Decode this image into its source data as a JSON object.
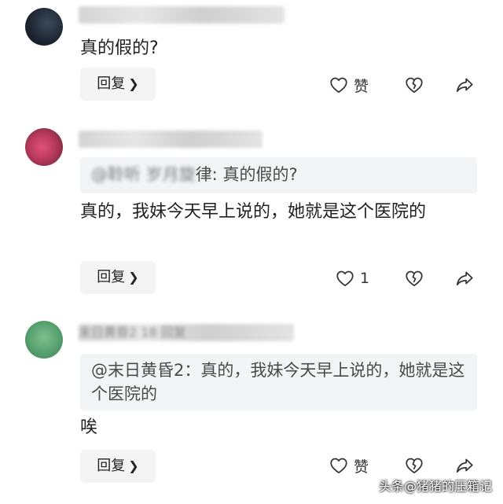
{
  "comments": [
    {
      "text": "真的假的?",
      "reply_label": "回复",
      "like_label": "赞"
    },
    {
      "quote_name_blur": "@聆听  岁月旋",
      "quote_name_tail": "律:",
      "quote_text": "真的假的?",
      "text": "真的，我妹今天早上说的，她就是这个医院的",
      "reply_label": "回复",
      "like_count": "1"
    },
    {
      "name_blur": "末日黄昏2  18  回复",
      "quote_text": "@末日黄昏2：真的，我妹今天早上说的，她就是这个医院的",
      "text": "唉",
      "reply_label": "回复",
      "like_label": "赞"
    }
  ],
  "watermark": "头条@猪猪的压箱记",
  "icons": {
    "like": "heart-outline-icon",
    "dislike": "broken-heart-icon",
    "share": "share-arrow-icon",
    "chevron": "chevron-right-icon"
  },
  "colors": {
    "background": "#ffffff",
    "quote_bg": "#f3f4f6",
    "button_bg": "#f4f4f4",
    "icon": "#333333"
  }
}
